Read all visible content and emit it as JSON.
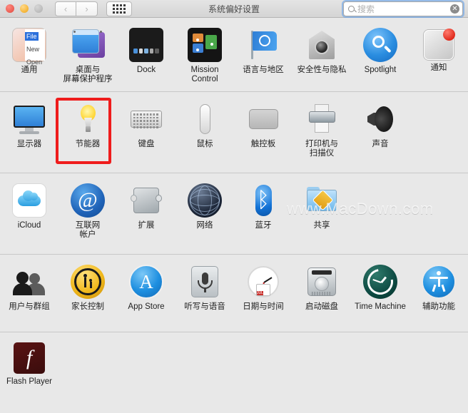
{
  "window": {
    "title": "系统偏好设置",
    "traffic_lights": [
      "close",
      "minimize",
      "zoom-disabled"
    ]
  },
  "toolbar": {
    "back_label": "‹",
    "forward_label": "›",
    "grid_view_label": "show-all-grid",
    "search": {
      "placeholder": "搜索",
      "value": "",
      "clear_label": "✕"
    }
  },
  "watermark": {
    "text": "www.MacDown.com"
  },
  "highlight": {
    "color": "#ef1c1c",
    "target": "节能器"
  },
  "rows": [
    {
      "items": [
        {
          "label": "通用",
          "icon": "general-icon",
          "menu": {
            "file": "File",
            "new": "New",
            "open": "Open"
          }
        },
        {
          "label": "桌面与\n屏幕保护程序",
          "icon": "desktop-screensaver-icon"
        },
        {
          "label": "Dock",
          "icon": "dock-icon"
        },
        {
          "label": "Mission\nControl",
          "icon": "mission-control-icon"
        },
        {
          "label": "语言与地区",
          "icon": "language-region-icon"
        },
        {
          "label": "安全性与隐私",
          "icon": "security-privacy-icon"
        },
        {
          "label": "Spotlight",
          "icon": "spotlight-icon"
        },
        {
          "label": "通知",
          "icon": "notifications-icon"
        }
      ]
    },
    {
      "items": [
        {
          "label": "显示器",
          "icon": "displays-icon"
        },
        {
          "label": "节能器",
          "icon": "energy-saver-icon",
          "highlighted": true
        },
        {
          "label": "键盘",
          "icon": "keyboard-icon"
        },
        {
          "label": "鼠标",
          "icon": "mouse-icon"
        },
        {
          "label": "触控板",
          "icon": "trackpad-icon"
        },
        {
          "label": "打印机与\n扫描仪",
          "icon": "printers-scanners-icon"
        },
        {
          "label": "声音",
          "icon": "sound-icon"
        }
      ]
    },
    {
      "items": [
        {
          "label": "iCloud",
          "icon": "icloud-icon"
        },
        {
          "label": "互联网\n帐户",
          "icon": "internet-accounts-icon"
        },
        {
          "label": "扩展",
          "icon": "extensions-icon"
        },
        {
          "label": "网络",
          "icon": "network-icon"
        },
        {
          "label": "蓝牙",
          "icon": "bluetooth-icon"
        },
        {
          "label": "共享",
          "icon": "sharing-icon"
        }
      ]
    },
    {
      "items": [
        {
          "label": "用户与群组",
          "icon": "users-groups-icon"
        },
        {
          "label": "家长控制",
          "icon": "parental-controls-icon"
        },
        {
          "label": "App Store",
          "icon": "app-store-icon"
        },
        {
          "label": "听写与语音",
          "icon": "dictation-speech-icon"
        },
        {
          "label": "日期与时间",
          "icon": "date-time-icon",
          "calendar": {
            "month": "JUL",
            "day": "18"
          }
        },
        {
          "label": "启动磁盘",
          "icon": "startup-disk-icon"
        },
        {
          "label": "Time Machine",
          "icon": "time-machine-icon"
        },
        {
          "label": "辅助功能",
          "icon": "accessibility-icon"
        }
      ]
    },
    {
      "items": [
        {
          "label": "Flash Player",
          "icon": "flash-player-icon"
        }
      ]
    }
  ]
}
